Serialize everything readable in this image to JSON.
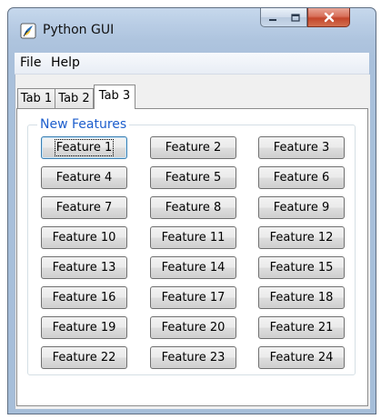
{
  "window": {
    "title": "Python GUI",
    "icon": "python-feather-icon"
  },
  "title_controls": {
    "minimize_icon": "minimize-icon",
    "maximize_icon": "maximize-icon",
    "close_icon": "close-icon"
  },
  "menu": {
    "items": [
      "File",
      "Help"
    ]
  },
  "tabs": {
    "labels": [
      "Tab 1",
      "Tab 2",
      "Tab 3"
    ],
    "selected": "Tab 3"
  },
  "group": {
    "title": "New Features",
    "title_color": "#1d5ecd",
    "buttons": [
      "Feature 1",
      "Feature 2",
      "Feature 3",
      "Feature 4",
      "Feature 5",
      "Feature 6",
      "Feature 7",
      "Feature 8",
      "Feature 9",
      "Feature 10",
      "Feature 11",
      "Feature 12",
      "Feature 13",
      "Feature 14",
      "Feature 15",
      "Feature 16",
      "Feature 17",
      "Feature 18",
      "Feature 19",
      "Feature 20",
      "Feature 21",
      "Feature 22",
      "Feature 23",
      "Feature 24"
    ],
    "focused_button": "Feature 1"
  }
}
